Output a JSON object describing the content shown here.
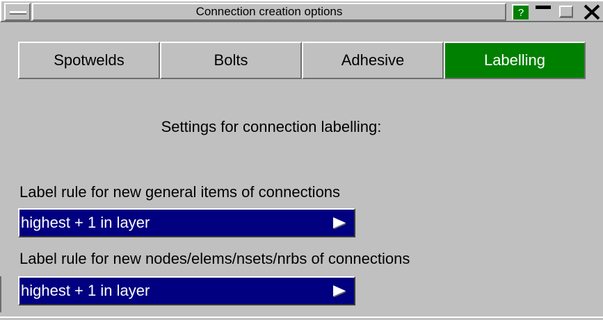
{
  "window": {
    "title": "Connection creation options",
    "help_label": "?"
  },
  "tabs": [
    {
      "label": "Spotwelds",
      "active": false
    },
    {
      "label": "Bolts",
      "active": false
    },
    {
      "label": "Adhesive",
      "active": false
    },
    {
      "label": "Labelling",
      "active": true
    }
  ],
  "main": {
    "heading": "Settings for connection labelling:",
    "general_rule": {
      "label": "Label rule for new general items of connections",
      "value": "highest + 1 in layer"
    },
    "nodes_rule": {
      "label": "Label rule for new nodes/elems/nsets/nrbs of connections",
      "value": "highest + 1 in layer"
    }
  },
  "colors": {
    "active_tab": "#008000",
    "dropdown_bg": "#000080",
    "panel_bg": "#c0c0c0"
  }
}
